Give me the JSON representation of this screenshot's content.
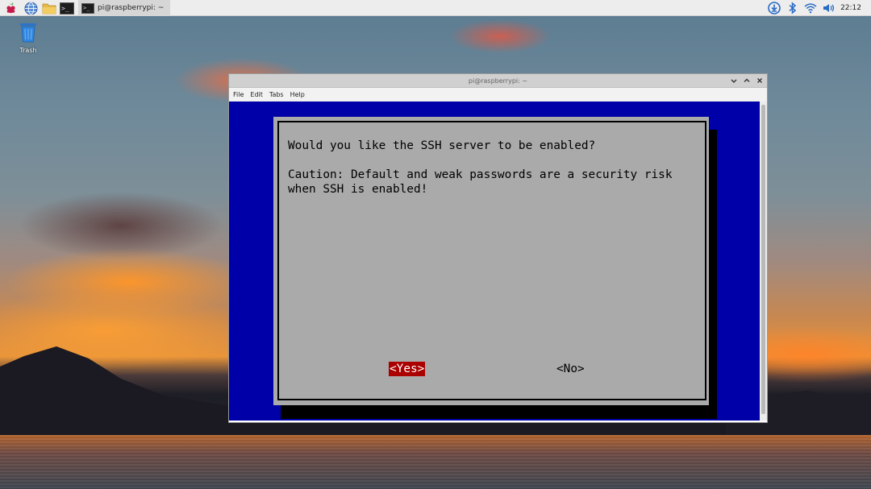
{
  "taskbar": {
    "task_label": "pi@raspberrypi: ~",
    "term_glyph": ">_",
    "clock": "22:12",
    "icons": [
      "raspberry-menu-icon",
      "web-browser-icon",
      "file-manager-icon",
      "terminal-icon",
      "update-icon",
      "bluetooth-icon",
      "wifi-icon",
      "volume-icon"
    ]
  },
  "desktop": {
    "trash_label": "Trash"
  },
  "window": {
    "title": "pi@raspberrypi: ~",
    "controls": [
      "minimize",
      "maximize",
      "close"
    ],
    "menu": {
      "file": "File",
      "edit": "Edit",
      "tabs": "Tabs",
      "help": "Help"
    }
  },
  "dialog": {
    "question": "Would you like the SSH server to be enabled?",
    "caution_line1": "Caution: Default and weak passwords are a security risk",
    "caution_line2": "when SSH is enabled!",
    "yes_label": "<Yes>",
    "no_label": "<No>"
  },
  "colors": {
    "terminal_bg": "#0000a8",
    "dialog_bg": "#aaaaaa",
    "selected_button": "#aa0000"
  }
}
